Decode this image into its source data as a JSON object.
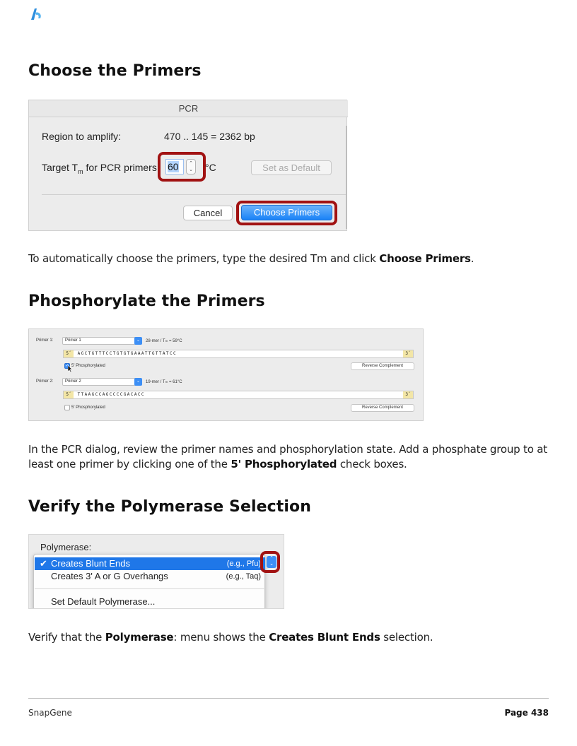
{
  "brand": {
    "logo_icon": "snapgene-logo-icon",
    "accent": "#2f8fde"
  },
  "sections": {
    "choose": {
      "heading": "Choose the Primers",
      "paragraph_pre": "To automatically choose the primers, type the desired Tm and click ",
      "paragraph_bold": "Choose Primers",
      "paragraph_post": "."
    },
    "phos": {
      "heading": "Phosphorylate the Primers",
      "paragraph_pre": "In the PCR dialog, review the primer names and phosphorylation state. Add a phosphate group to at least one primer by clicking one of the ",
      "paragraph_bold": "5' Phosphorylated",
      "paragraph_post": " check boxes."
    },
    "verify": {
      "heading": "Verify the Polymerase Selection",
      "paragraph_pre": "Verify that the ",
      "paragraph_bold1": "Polymerase",
      "paragraph_mid": ": menu shows the ",
      "paragraph_bold2": "Creates Blunt Ends",
      "paragraph_post": " selection."
    }
  },
  "pcr_dialog": {
    "title": "PCR",
    "region_label": "Region to amplify:",
    "region_value": "470 .. 145  =  2362 bp",
    "target_label_pre": "Target T",
    "target_label_sub": "m",
    "target_label_post": " for PCR primers:",
    "tm_value": "60",
    "tm_unit": "°C",
    "set_default_label": "Set as Default",
    "cancel_label": "Cancel",
    "choose_primers_label": "Choose Primers",
    "highlight_color": "#a11212"
  },
  "primers_panel": {
    "primer1": {
      "label": "Primer 1:",
      "name": "Primer 1",
      "info": "28-mer  /  Tₘ  =  59°C",
      "five": "5´",
      "sequence": "AGCTGTTTCCTGTGTGAAATTGTTATCC",
      "three": "3´",
      "phos_label": "5' Phosphorylated",
      "phos_checked": true,
      "rc_label": "Reverse Complement"
    },
    "primer2": {
      "label": "Primer 2:",
      "name": "Primer 2",
      "info": "19-mer  /  Tₘ  =  61°C",
      "five": "5´",
      "sequence": "TTAAGCCAGCCCCGACACC",
      "three": "3´",
      "phos_label": "5' Phosphorylated",
      "phos_checked": false,
      "rc_label": "Reverse Complement"
    }
  },
  "polymerase_panel": {
    "label": "Polymerase:",
    "options": [
      {
        "label": "Creates Blunt Ends",
        "hint": "(e.g., Pfu)",
        "selected": true
      },
      {
        "label": "Creates 3' A or G Overhangs",
        "hint": "(e.g., Taq)",
        "selected": false
      }
    ],
    "set_default": "Set Default Polymerase...",
    "checkmark": "✔"
  },
  "footer": {
    "left": "SnapGene",
    "right": "Page 438"
  }
}
